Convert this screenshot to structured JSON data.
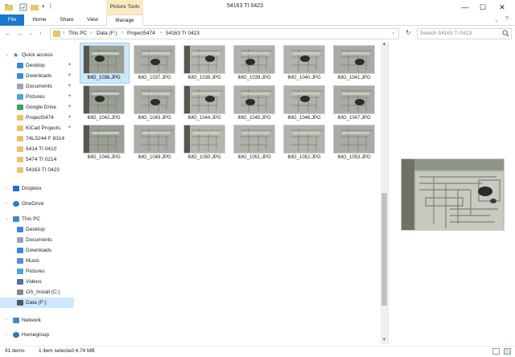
{
  "window": {
    "title": "54163 TI 0423",
    "picture_tools_label": "Picture Tools",
    "minimize": "—",
    "maximize": "☐",
    "close": "✕"
  },
  "ribbon": {
    "tabs": [
      "File",
      "Home",
      "Share",
      "View",
      "Manage"
    ]
  },
  "address": {
    "crumbs": [
      "This PC",
      "Data (F:)",
      "Project5474",
      "54163 TI 0423"
    ],
    "search_placeholder": "Search 54163 TI 0423"
  },
  "sidebar": {
    "quick_access": "Quick access",
    "items": [
      {
        "label": "Desktop",
        "icon": "desktop-icon",
        "pinned": true
      },
      {
        "label": "Downloads",
        "icon": "downloads-icon",
        "pinned": true
      },
      {
        "label": "Documents",
        "icon": "documents-icon",
        "pinned": true
      },
      {
        "label": "Pictures",
        "icon": "pictures-icon",
        "pinned": true
      },
      {
        "label": "Google Drive",
        "icon": "google-drive-icon",
        "pinned": true
      },
      {
        "label": "Project5474",
        "icon": "folder-icon",
        "pinned": true
      },
      {
        "label": "KiCad Projects",
        "icon": "folder-icon",
        "pinned": true
      },
      {
        "label": "74LS244 F 8314",
        "icon": "folder-icon",
        "pinned": false
      },
      {
        "label": "5414 TI 0410",
        "icon": "folder-icon",
        "pinned": false
      },
      {
        "label": "5474 TI 0214",
        "icon": "folder-icon",
        "pinned": false
      },
      {
        "label": "54163 TI 0423",
        "icon": "folder-icon",
        "pinned": false
      }
    ],
    "dropbox": "Dropbox",
    "onedrive": "OneDrive",
    "this_pc": "This PC",
    "pc_items": [
      {
        "label": "Desktop",
        "icon": "desktop-icon"
      },
      {
        "label": "Documents",
        "icon": "documents-icon"
      },
      {
        "label": "Downloads",
        "icon": "downloads-icon"
      },
      {
        "label": "Music",
        "icon": "music-icon"
      },
      {
        "label": "Pictures",
        "icon": "pictures-icon"
      },
      {
        "label": "Videos",
        "icon": "videos-icon"
      },
      {
        "label": "OS_Install (C:)",
        "icon": "drive-icon"
      },
      {
        "label": "Data (F:)",
        "icon": "drive-icon"
      }
    ],
    "network": "Network",
    "homegroup": "Homegroup"
  },
  "files": [
    "IMG_1036.JPG",
    "IMG_1037.JPG",
    "IMG_1038.JPG",
    "IMG_1039.JPG",
    "IMG_1040.JPG",
    "IMG_1041.JPG",
    "IMG_1042.JPG",
    "IMG_1043.JPG",
    "IMG_1044.JPG",
    "IMG_1045.JPG",
    "IMG_1046.JPG",
    "IMG_1047.JPG",
    "IMG_1048.JPG",
    "IMG_1049.JPG",
    "IMG_1050.JPG",
    "IMG_1051.JPG",
    "IMG_1052.JPG",
    "IMG_1053.JPG"
  ],
  "selected_file": "IMG_1036.JPG",
  "status": {
    "count": "91 items",
    "selection": "1 item selected  4.74 MB"
  },
  "colors": {
    "accent": "#1979ca",
    "selection": "#cce8ff",
    "folder": "#e8c56a",
    "picture_tools": "#f9eac0"
  }
}
